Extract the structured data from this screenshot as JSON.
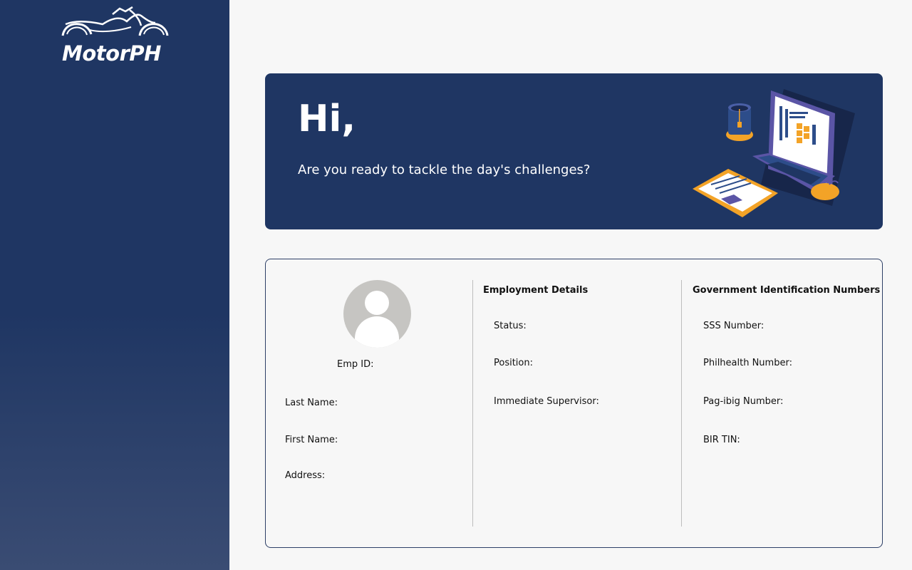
{
  "brand": {
    "name": "MotorPH"
  },
  "hero": {
    "greeting": "Hi,",
    "subtitle": "Are you ready to tackle the day's challenges?"
  },
  "profile": {
    "emp_id_label": "Emp ID:",
    "last_name_label": "Last Name:",
    "first_name_label": "First Name:",
    "address_label": "Address:"
  },
  "employment": {
    "heading": "Employment Details",
    "status_label": "Status:",
    "position_label": "Position:",
    "supervisor_label": "Immediate Supervisor:"
  },
  "government": {
    "heading": "Government Identification Numbers",
    "sss_label": "SSS Number:",
    "philhealth_label": "Philhealth Number:",
    "pagibig_label": "Pag-ibig Number:",
    "tin_label": "BIR TIN:"
  },
  "colors": {
    "navy": "#1f3663",
    "background": "#f7f7f7",
    "accent_orange": "#f3a327",
    "accent_purple": "#5b55a6"
  },
  "icons": {
    "avatar": "user-placeholder-icon",
    "logo": "motorcycle-logo",
    "illustration": "laptop-workspace-illustration"
  }
}
